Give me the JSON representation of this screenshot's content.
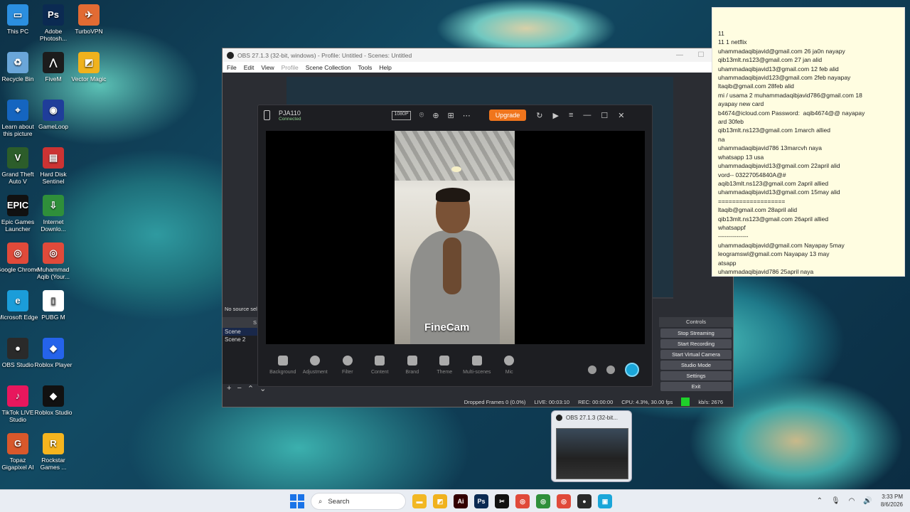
{
  "desktop_icons": [
    {
      "name": "This PC",
      "color": "#2b8fe0",
      "glyph": "▭"
    },
    {
      "name": "Adobe Photosh...",
      "color": "#0b2a52",
      "glyph": "Ps"
    },
    {
      "name": "TurboVPN",
      "color": "#e26b33",
      "glyph": "✈"
    },
    {
      "name": "Recycle Bin",
      "color": "#6aa6d9",
      "glyph": "♻"
    },
    {
      "name": "FiveM",
      "color": "#1c1c1c",
      "glyph": "⋀"
    },
    {
      "name": "Vector Magic",
      "color": "#f0b21d",
      "glyph": "◩"
    },
    {
      "name": "Learn about this picture",
      "color": "#1565c0",
      "glyph": "⌖"
    },
    {
      "name": "GameLoop",
      "color": "#1f3d9a",
      "glyph": "◉"
    },
    {
      "name": "Grand Theft Auto V",
      "color": "#2c5d2a",
      "glyph": "V"
    },
    {
      "name": "Hard Disk Sentinel",
      "color": "#cc3333",
      "glyph": "▤"
    },
    {
      "name": "Epic Games Launcher",
      "color": "#111111",
      "glyph": "EPIC"
    },
    {
      "name": "Internet Downlo...",
      "color": "#2f8f3a",
      "glyph": "⇩"
    },
    {
      "name": "Google Chrome",
      "color": "#e04a3a",
      "glyph": "◎"
    },
    {
      "name": "Muhammad Aqib (Your...",
      "color": "#e04a3a",
      "glyph": "◎"
    },
    {
      "name": "Microsoft Edge",
      "color": "#1b9dd9",
      "glyph": "e"
    },
    {
      "name": "PUBG M",
      "color": "#ffffff",
      "glyph": "▯"
    },
    {
      "name": "OBS Studio",
      "color": "#2a2a2a",
      "glyph": "●"
    },
    {
      "name": "Roblox Player",
      "color": "#2563eb",
      "glyph": "◆"
    },
    {
      "name": "TikTok LIVE Studio",
      "color": "#e8175d",
      "glyph": "♪"
    },
    {
      "name": "Roblox Studio",
      "color": "#111111",
      "glyph": "◆"
    },
    {
      "name": "Topaz Gigapixel AI",
      "color": "#d9582b",
      "glyph": "G"
    },
    {
      "name": "Rockstar Games ...",
      "color": "#f6b51e",
      "glyph": "R"
    }
  ],
  "obs": {
    "title": "OBS 27.1.3 (32-bit, windows) - Profile: Untitled - Scenes: Untitled",
    "menu": [
      "File",
      "Edit",
      "View",
      "Profile",
      "Scene Collection",
      "Tools",
      "Help"
    ],
    "no_source_msg": "No source sele",
    "scenes_header": "S",
    "scenes": [
      "Scene",
      "Scene 2"
    ],
    "controls_header": "Controls",
    "controls": [
      "Stop Streaming",
      "Start Recording",
      "Start Virtual Camera",
      "Studio Mode",
      "Settings",
      "Exit"
    ],
    "status": {
      "dropped": "Dropped Frames 0 (0.0%)",
      "live": "LIVE: 00:03:10",
      "rec": "REC: 00:00:00",
      "cpu": "CPU: 4.3%, 30.00 fps",
      "kbps": "kb/s: 2676"
    }
  },
  "finecam": {
    "device": "PJA110",
    "connection": "Connected",
    "resolution_badge": "1080P",
    "upgrade_label": "Upgrade",
    "brand_overlay": "FineCam",
    "tools": [
      "Background",
      "Adjustment",
      "Filter",
      "Content",
      "Brand",
      "Theme",
      "Multi-scenes",
      "Mic"
    ]
  },
  "notepad": {
    "lines": [
      "11",
      "11 1 netflix",
      "uhammadaqibjavid@gmail.com 26 ja0n nayapy",
      "qib13mlt.ns123@gmail.com 27 jan alid",
      "uhammadaqibjavid13@gmail.com 12 feb alid",
      "uhammadaqibjavid123@gmail.com 2feb nayapay",
      "ltaqib@gmail.com 28feb alid",
      "mi / usama 2 muhammadaqibjavid786@gmail.com 18",
      "ayapay new card",
      "b4674@icloud.com Password:  aqib4674@@ nayapay",
      "ard 30feb",
      "qib13mlt.ns123@gmail.com 1march allied",
      "na",
      "uhammadaqibjavid786 13marcvh naya",
      "whatsapp 13 usa",
      "uhammadaqibjavid13@gmail.com 22april alid",
      "vord-- 03227054840A@#",
      "aqib13mlt.ns123@gmail.com 2april allied",
      "uhammadaqibjavid13@gmail.com 15may alid",
      "===================",
      "ltaqib@gmail.com 28april alid",
      "qib13mlt.ns123@gmail.com 26april allied",
      "whatsappf",
      "---------------",
      "uhammadaqibjavid@gmail.com Nayapay 5may",
      "leogramswl@gmail.com Nayapay 13 may",
      "atsapp",
      "uhammadaqibjavid786 25april naya"
    ]
  },
  "taskbar_preview": {
    "title": "OBS 27.1.3 (32-bit..."
  },
  "taskbar": {
    "search_placeholder": "Search",
    "apps": [
      {
        "name": "file-explorer",
        "color": "#f2b824",
        "glyph": "▬"
      },
      {
        "name": "vector-magic",
        "color": "#f0b21d",
        "glyph": "◩"
      },
      {
        "name": "illustrator",
        "color": "#330000",
        "glyph": "Ai"
      },
      {
        "name": "photoshop",
        "color": "#0b2a52",
        "glyph": "Ps"
      },
      {
        "name": "capcut",
        "color": "#111111",
        "glyph": "✂"
      },
      {
        "name": "chrome",
        "color": "#e04a3a",
        "glyph": "◎"
      },
      {
        "name": "chrome-profile",
        "color": "#2f8f3a",
        "glyph": "◎"
      },
      {
        "name": "chrome-profile-2",
        "color": "#e04a3a",
        "glyph": "◎"
      },
      {
        "name": "obs",
        "color": "#2a2a2a",
        "glyph": "●"
      },
      {
        "name": "finecam",
        "color": "#1aa6d9",
        "glyph": "▣"
      }
    ],
    "time": "3:33 PM",
    "date": "8/6/2026"
  }
}
